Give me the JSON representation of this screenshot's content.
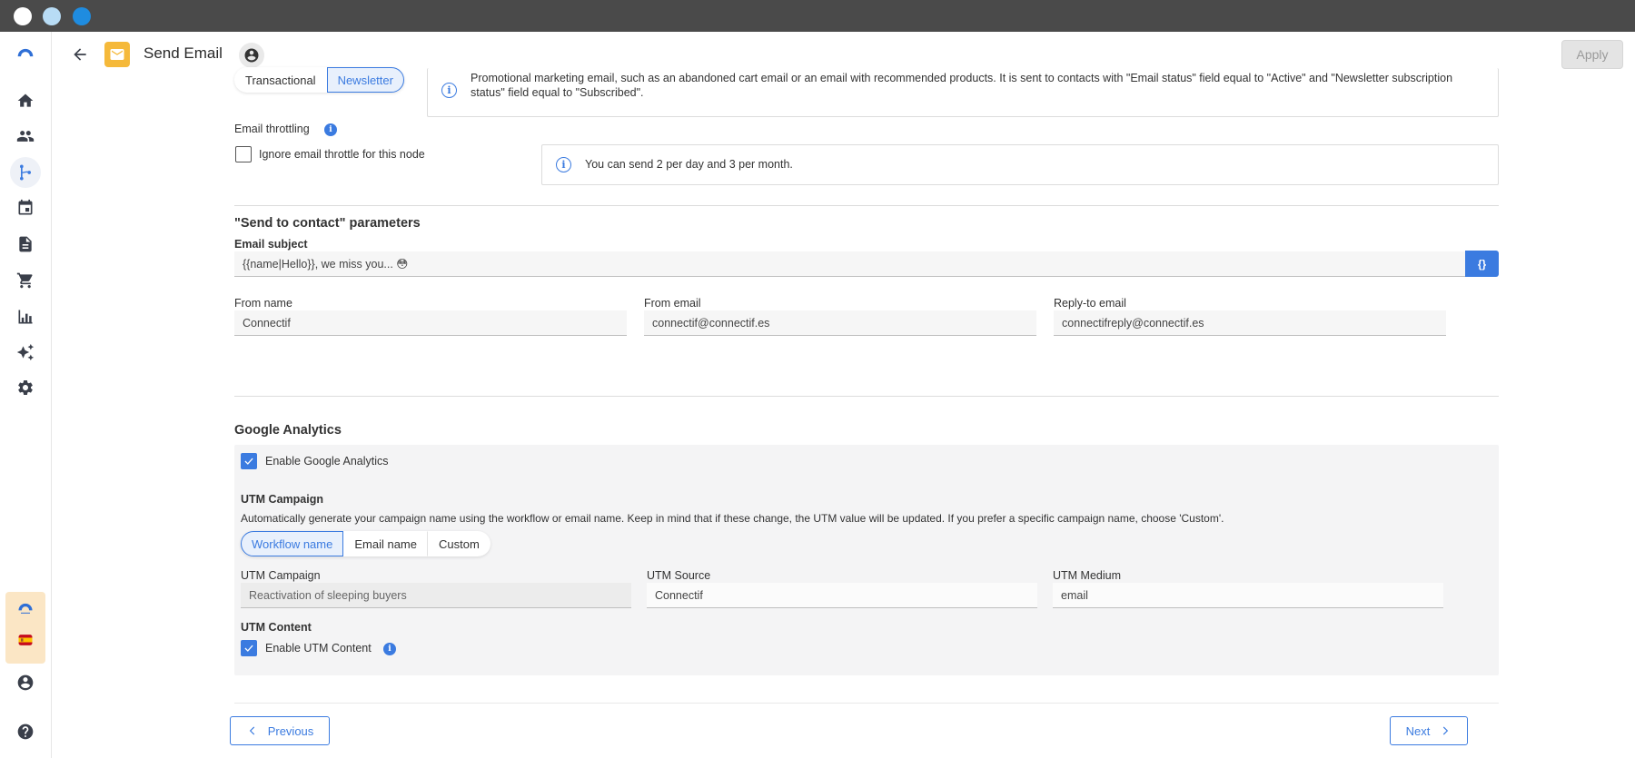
{
  "window": {
    "dot_colors": [
      "#ffffff",
      "#b8dcf5",
      "#1f8ce0"
    ]
  },
  "sidebar": {
    "items": [
      {
        "icon": "logo-icon"
      },
      {
        "icon": "home-icon"
      },
      {
        "icon": "contacts-icon"
      },
      {
        "icon": "workflow-icon",
        "active": true
      },
      {
        "icon": "calendar-icon"
      },
      {
        "icon": "document-icon"
      },
      {
        "icon": "cart-icon"
      },
      {
        "icon": "analytics-icon"
      },
      {
        "icon": "ai-sparkle-icon"
      },
      {
        "icon": "settings-icon"
      },
      {
        "icon": "account-logo-icon"
      },
      {
        "icon": "spain-flag-icon"
      },
      {
        "icon": "user-account-icon"
      },
      {
        "icon": "help-icon"
      }
    ]
  },
  "header": {
    "title": "Send Email",
    "apply_label": "Apply"
  },
  "email_type": {
    "options": [
      "Transactional",
      "Newsletter"
    ],
    "selected": "Newsletter",
    "info": "Promotional marketing email, such as an abandoned cart email or an email with recommended products. It is sent to contacts with \"Email status\" field equal to \"Active\" and \"Newsletter subscription status\" field equal to \"Subscribed\"."
  },
  "throttling": {
    "label": "Email throttling",
    "checkbox_label": "Ignore email throttle for this node",
    "checked": false,
    "info": "You can send 2 per day and 3 per month."
  },
  "send_params": {
    "title": "\"Send to contact\" parameters",
    "subject_label": "Email subject",
    "subject_value": "{{name|Hello}}, we miss you... 😳",
    "var_button": "{}",
    "from_name_label": "From name",
    "from_name_value": "Connectif",
    "from_email_label": "From email",
    "from_email_value": "connectif@connectif.es",
    "reply_to_label": "Reply-to email",
    "reply_to_value": "connectifreply@connectif.es"
  },
  "google_analytics": {
    "title": "Google Analytics",
    "enable_label": "Enable Google Analytics",
    "enabled": true,
    "utm_campaign_title": "UTM Campaign",
    "utm_campaign_desc": "Automatically generate your campaign name using the workflow or email name. Keep in mind that if these change, the UTM value will be updated. If you prefer a specific campaign name, choose 'Custom'.",
    "campaign_options": [
      "Workflow name",
      "Email name",
      "Custom"
    ],
    "campaign_selected": "Workflow name",
    "utm_campaign_label": "UTM Campaign",
    "utm_campaign_value": "Reactivation of sleeping buyers",
    "utm_source_label": "UTM Source",
    "utm_source_value": "Connectif",
    "utm_medium_label": "UTM Medium",
    "utm_medium_value": "email",
    "utm_content_title": "UTM Content",
    "utm_content_enable_label": "Enable UTM Content",
    "utm_content_enabled": true
  },
  "footer": {
    "previous_label": "Previous",
    "next_label": "Next"
  },
  "colors": {
    "accent": "#3b7be0",
    "node_icon": "#f5b93a",
    "titlebar": "#4a4a4a"
  }
}
